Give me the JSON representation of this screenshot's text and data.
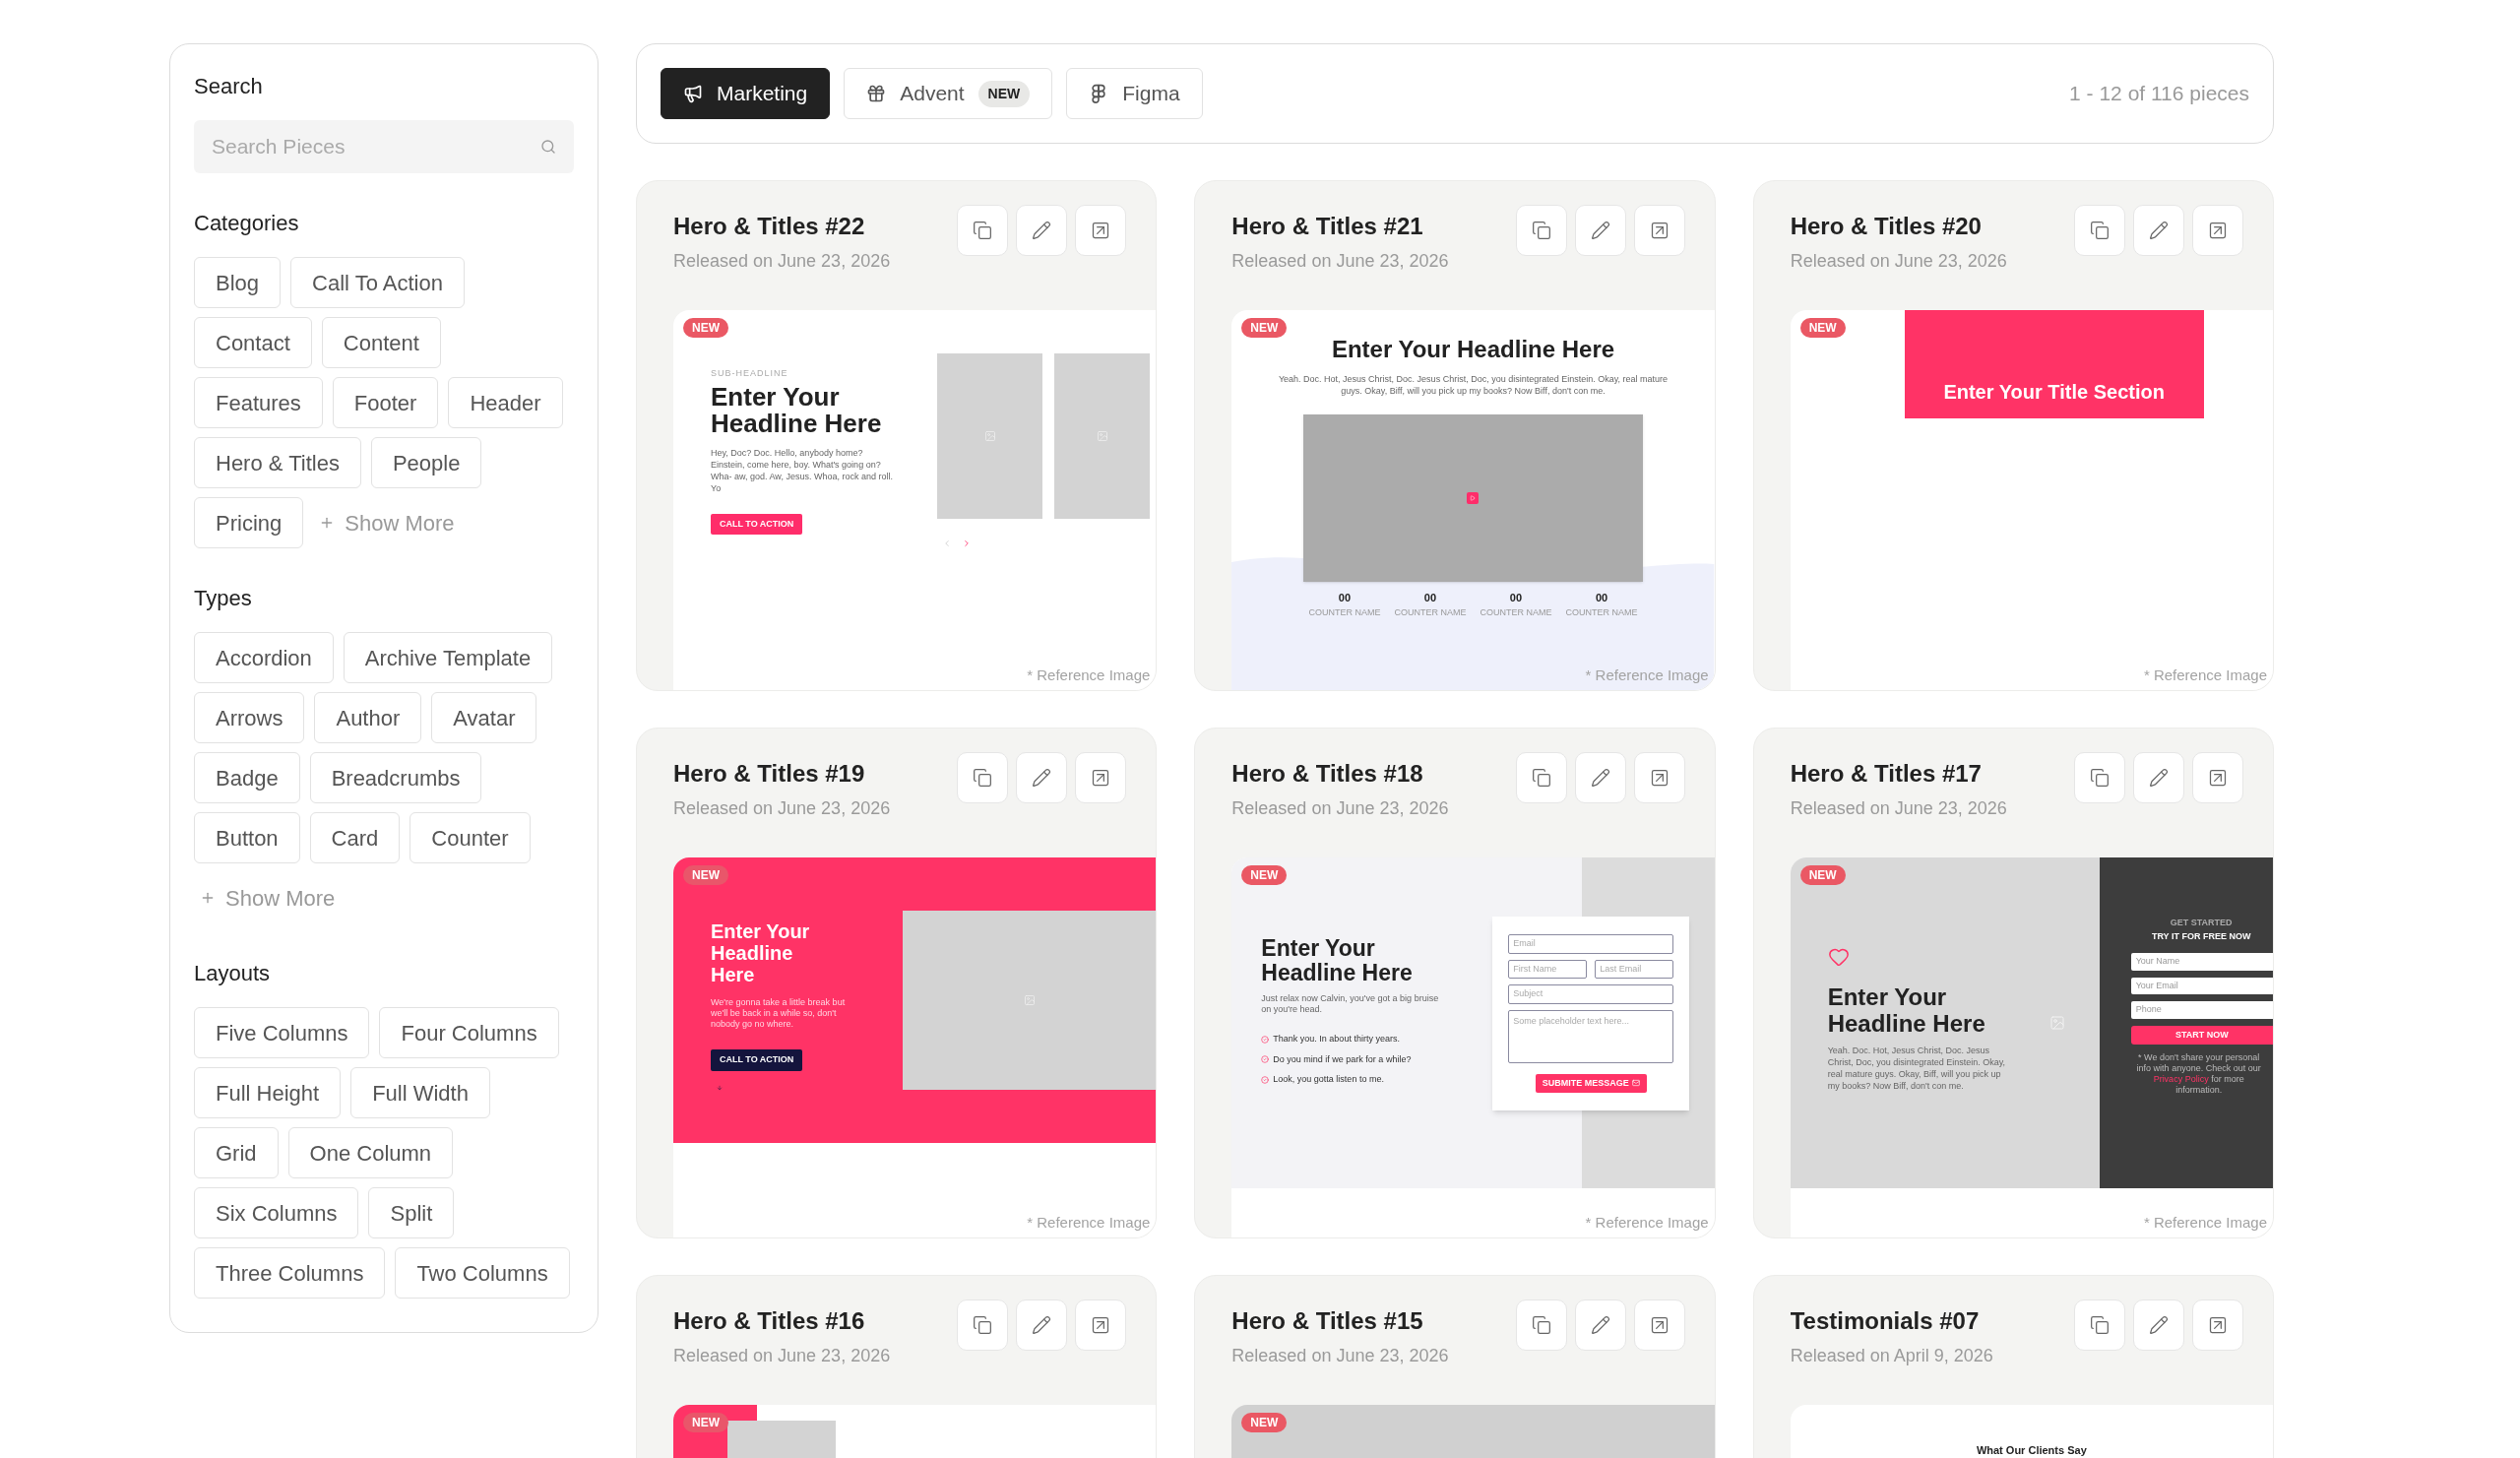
{
  "sidebar": {
    "search": {
      "label": "Search",
      "placeholder": "Search Pieces"
    },
    "sections": [
      {
        "title": "Categories",
        "items": [
          "Blog",
          "Call To Action",
          "Contact",
          "Content",
          "Features",
          "Footer",
          "Header",
          "Hero & Titles",
          "People",
          "Pricing"
        ],
        "more": "Show More"
      },
      {
        "title": "Types",
        "items": [
          "Accordion",
          "Archive Template",
          "Arrows",
          "Author",
          "Avatar",
          "Badge",
          "Breadcrumbs",
          "Button",
          "Card",
          "Counter"
        ],
        "more": "Show More"
      },
      {
        "title": "Layouts",
        "items": [
          "Five Columns",
          "Four Columns",
          "Full Height",
          "Full Width",
          "Grid",
          "One Column",
          "Six Columns",
          "Split",
          "Three Columns",
          "Two Columns"
        ]
      }
    ]
  },
  "toolbar": {
    "tabs": [
      {
        "label": "Marketing",
        "selected": true
      },
      {
        "label": "Advent",
        "selected": false,
        "badge": "NEW"
      },
      {
        "label": "Figma",
        "selected": false
      }
    ],
    "count": "1 - 12 of 116 pieces"
  },
  "cards": [
    {
      "title": "Hero & Titles #22",
      "date": "Released on June 23, 2026",
      "reference": "* Reference Image",
      "preview": {
        "kind": "slider",
        "badge": "NEW",
        "sub_headline": "SUB-HEADLINE",
        "headline": "Enter Your Headline Here",
        "body": "Hey, Doc? Doc. Hello, anybody home? Einstein, come here, boy. What's going on? Wha- aw, god. Aw, Jesus. Whoa, rock and roll. Yo",
        "button": "CALL TO ACTION"
      }
    },
    {
      "title": "Hero & Titles #21",
      "date": "Released on June 23, 2026",
      "reference": "* Reference Image",
      "preview": {
        "kind": "video",
        "badge": "NEW",
        "headline": "Enter Your Headline Here",
        "body": "Yeah. Doc. Hot, Jesus Christ, Doc. Jesus Christ, Doc, you disintegrated Einstein. Okay, real mature guys. Okay, Biff, will you pick up my books? Now Biff, don't con me.",
        "counters": [
          {
            "value": "00",
            "label": "COUNTER NAME"
          },
          {
            "value": "00",
            "label": "COUNTER NAME"
          },
          {
            "value": "00",
            "label": "COUNTER NAME"
          },
          {
            "value": "00",
            "label": "COUNTER NAME"
          }
        ]
      }
    },
    {
      "title": "Hero & Titles #20",
      "date": "Released on June 23, 2026",
      "reference": "* Reference Image",
      "preview": {
        "kind": "banner",
        "badge": "NEW",
        "headline": "Enter Your Title Section"
      }
    },
    {
      "title": "Hero & Titles #19",
      "date": "Released on June 23, 2026",
      "reference": "* Reference Image",
      "preview": {
        "kind": "pink_hero",
        "badge": "NEW",
        "headline": "Enter Your Headline Here",
        "body": "We're gonna take a little break but we'll be back in a while so, don't nobody go no where.",
        "button": "CALL TO ACTION"
      }
    },
    {
      "title": "Hero & Titles #18",
      "date": "Released on June 23, 2026",
      "reference": "* Reference Image",
      "preview": {
        "kind": "contact",
        "badge": "NEW",
        "headline": "Enter Your Headline Here",
        "body": "Just relax now Calvin, you've got a big bruise on you're head.",
        "checklist": [
          "Thank you. In about thirty years.",
          "Do you mind if we park for a while?",
          "Look, you gotta listen to me."
        ],
        "fields": [
          [
            "Email"
          ],
          [
            "First Name",
            "Last Email"
          ],
          [
            "Subject"
          ]
        ],
        "message": "Some placeholder text here...",
        "button": "SUBMITE MESSAGE"
      }
    },
    {
      "title": "Hero & Titles #17",
      "date": "Released on June 23, 2026",
      "reference": "* Reference Image",
      "preview": {
        "kind": "signup",
        "badge": "NEW",
        "headline": "Enter Your Headline Here",
        "body": "Yeah. Doc. Hot, Jesus Christ, Doc. Jesus Christ, Doc, you disintegrated Einstein. Okay, real mature guys. Okay, Biff, will you pick up my books? Now Biff, don't con me.",
        "eyebrow": "GET STARTED",
        "form_title": "TRY IT FOR FREE NOW",
        "fields": [
          "Your Name",
          "Your Email",
          "Phone"
        ],
        "button": "START NOW",
        "note": "* We don't share your personal info with anyone. Check out our",
        "link": "Privacy Policy",
        "note_end": "for more information."
      }
    },
    {
      "title": "Hero & Titles #16",
      "date": "Released on June 23, 2026",
      "preview": {
        "kind": "split_top",
        "badge": "NEW"
      }
    },
    {
      "title": "Hero & Titles #15",
      "date": "Released on June 23, 2026",
      "preview": {
        "kind": "gray_top",
        "badge": "NEW"
      }
    },
    {
      "title": "Testimonials #07",
      "date": "Released on April 9, 2026",
      "preview": {
        "kind": "testimonials",
        "headline": "What Our Clients Say"
      }
    }
  ]
}
